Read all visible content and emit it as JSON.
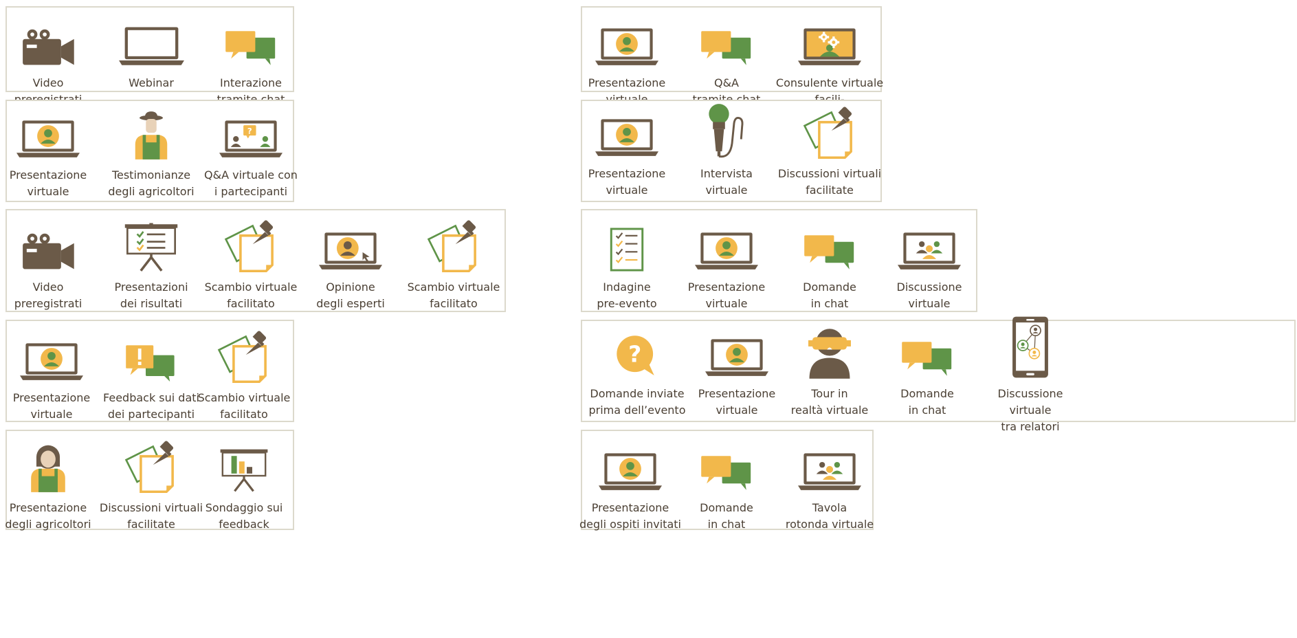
{
  "colors": {
    "brown": "#6b5a48",
    "orange": "#f2b84b",
    "green": "#5f9448",
    "border": "#dcd9cc",
    "text": "#4a3f33"
  },
  "panels": [
    {
      "id": "p1",
      "items": [
        {
          "icon": "video-camera-icon",
          "label": "Video\npreregistrati"
        },
        {
          "icon": "laptop-icon",
          "label": "Webinar"
        },
        {
          "icon": "chat-bubbles-icon",
          "label": "Interazione\ntramite chat"
        }
      ]
    },
    {
      "id": "p2",
      "items": [
        {
          "icon": "laptop-person-icon",
          "label": "Presentazione\nvirtuale"
        },
        {
          "icon": "farmer-icon",
          "label": "Testimonianze\ndegli agricoltori"
        },
        {
          "icon": "laptop-qa-icon",
          "label": "Q&A virtuale con\ni partecipanti"
        }
      ]
    },
    {
      "id": "p3",
      "items": [
        {
          "icon": "video-camera-icon",
          "label": "Video\npreregistrati"
        },
        {
          "icon": "presentation-board-icon",
          "label": "Presentazioni\ndei risultati"
        },
        {
          "icon": "pinned-notes-icon",
          "label": "Scambio virtuale\nfacilitato"
        },
        {
          "icon": "laptop-person-cursor-icon",
          "label": "Opinione\ndegli esperti"
        },
        {
          "icon": "pinned-notes-icon",
          "label": "Scambio virtuale\nfacilitato"
        }
      ]
    },
    {
      "id": "p4",
      "items": [
        {
          "icon": "laptop-person-icon",
          "label": "Presentazione\nvirtuale"
        },
        {
          "icon": "feedback-chat-icon",
          "label": "Feedback sui dati\ndei partecipanti"
        },
        {
          "icon": "pinned-notes-icon",
          "label": "Scambio virtuale\nfacilitato"
        }
      ]
    },
    {
      "id": "p5",
      "items": [
        {
          "icon": "woman-farmer-icon",
          "label": "Presentazione\ndegli agricoltori"
        },
        {
          "icon": "pinned-notes-icon",
          "label": "Discussioni virtuali\nfacilitate"
        },
        {
          "icon": "poll-board-icon",
          "label": "Sondaggio sui\nfeedback"
        }
      ]
    },
    {
      "id": "p6",
      "items": [
        {
          "icon": "laptop-person-icon",
          "label": "Presentazione\nvirtuale"
        },
        {
          "icon": "chat-bubbles-icon",
          "label": "Q&A\ntramite chat"
        },
        {
          "icon": "laptop-gears-icon",
          "label": "Consulente virtuale facili-\ntato dal brainstorming"
        }
      ]
    },
    {
      "id": "p7",
      "items": [
        {
          "icon": "laptop-person-icon",
          "label": "Presentazione\nvirtuale"
        },
        {
          "icon": "microphone-icon",
          "label": "Intervista\nvirtuale"
        },
        {
          "icon": "pinned-notes-icon",
          "label": "Discussioni virtuali\nfacilitate"
        }
      ]
    },
    {
      "id": "p8",
      "items": [
        {
          "icon": "checklist-icon",
          "label": "Indagine\npre-evento"
        },
        {
          "icon": "laptop-person-icon",
          "label": "Presentazione\nvirtuale"
        },
        {
          "icon": "chat-bubbles-icon",
          "label": "Domande\nin chat"
        },
        {
          "icon": "laptop-group-icon",
          "label": "Discussione\nvirtuale"
        }
      ]
    },
    {
      "id": "p9",
      "items": [
        {
          "icon": "question-bubble-icon",
          "label": "Domande inviate\nprima dell’evento"
        },
        {
          "icon": "laptop-person-icon",
          "label": "Presentazione\nvirtuale"
        },
        {
          "icon": "vr-headset-icon",
          "label": "Tour in\nrealtà virtuale"
        },
        {
          "icon": "chat-bubbles-icon",
          "label": "Domande\nin chat"
        },
        {
          "icon": "phone-network-icon",
          "label": "Discussione virtuale\ntra relatori"
        }
      ]
    },
    {
      "id": "p10",
      "items": [
        {
          "icon": "laptop-person-icon",
          "label": "Presentazione\ndegli ospiti invitati"
        },
        {
          "icon": "chat-bubbles-icon",
          "label": "Domande\nin chat"
        },
        {
          "icon": "laptop-group-icon",
          "label": "Tavola\nrotonda virtuale"
        }
      ]
    }
  ]
}
